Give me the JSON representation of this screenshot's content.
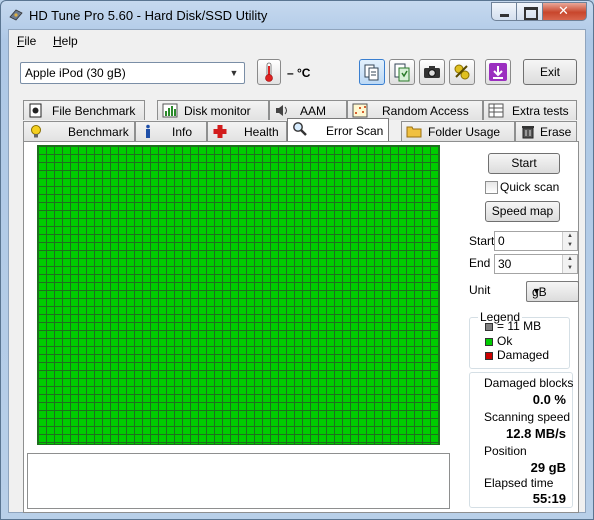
{
  "window": {
    "title": "HD Tune Pro 5.60 - Hard Disk/SSD Utility"
  },
  "menu": {
    "file": "File",
    "help": "Help"
  },
  "toolbar": {
    "drive": "Apple   iPod (30 gB)",
    "temperature": "– °C",
    "exit": "Exit"
  },
  "tabs_row1": [
    {
      "label": "File Benchmark",
      "icon": "file-benchmark-icon"
    },
    {
      "label": "Disk monitor",
      "icon": "disk-monitor-icon"
    },
    {
      "label": "AAM",
      "icon": "speaker-icon"
    },
    {
      "label": "Random Access",
      "icon": "random-access-icon"
    },
    {
      "label": "Extra tests",
      "icon": "extra-tests-icon"
    }
  ],
  "tabs_row2": [
    {
      "label": "Benchmark",
      "icon": "lightbulb-icon"
    },
    {
      "label": "Info",
      "icon": "info-icon"
    },
    {
      "label": "Health",
      "icon": "health-cross-icon"
    },
    {
      "label": "Error Scan",
      "icon": "magnifier-icon",
      "selected": true
    },
    {
      "label": "Folder Usage",
      "icon": "folder-icon"
    },
    {
      "label": "Erase",
      "icon": "trash-icon"
    }
  ],
  "scan": {
    "start_button": "Start",
    "quick_scan_label": "Quick scan",
    "quick_scan_checked": false,
    "speed_map_button": "Speed map",
    "start_label": "Start",
    "start_value": "0",
    "end_label": "End",
    "end_value": "30",
    "unit_label": "Unit",
    "unit_value": "gB"
  },
  "legend": {
    "title": "Legend",
    "block": "= 11 MB",
    "ok": "Ok",
    "damaged": "Damaged",
    "colors": {
      "block": "#808080",
      "ok": "#00cc00",
      "damaged": "#cc0000"
    }
  },
  "stats": {
    "damaged_blocks_label": "Damaged blocks",
    "damaged_blocks_value": "0.0 %",
    "scanning_speed_label": "Scanning speed",
    "scanning_speed_value": "12.8 MB/s",
    "position_label": "Position",
    "position_value": "29 gB",
    "elapsed_label": "Elapsed time",
    "elapsed_value": "55:19"
  }
}
